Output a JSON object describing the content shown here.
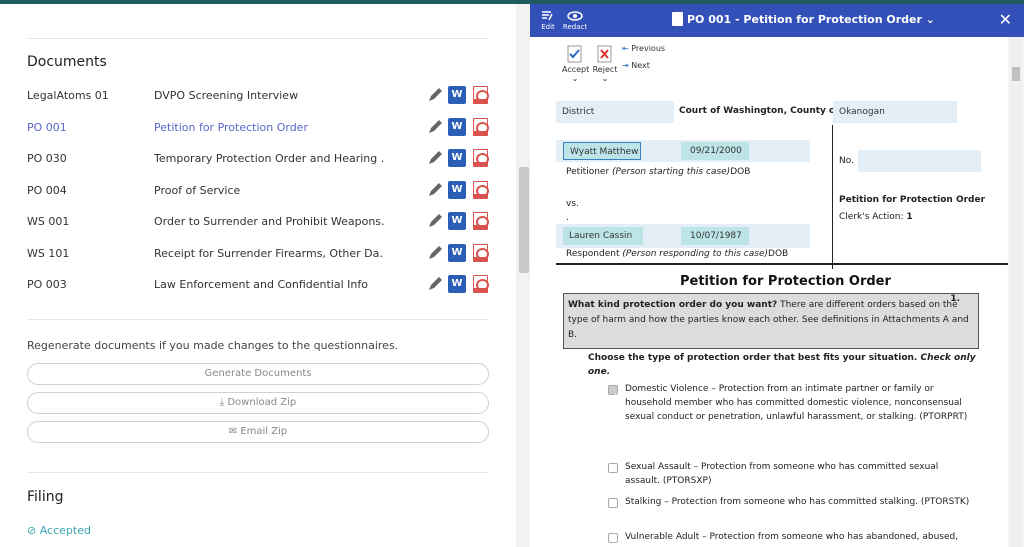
{
  "documents": {
    "heading": "Documents",
    "items": [
      {
        "code": "LegalAtoms 01",
        "title": "DVPO Screening Interview",
        "active": false
      },
      {
        "code": "PO 001",
        "title": "Petition for Protection Order",
        "active": true
      },
      {
        "code": "PO 030",
        "title": "Temporary Protection Order and Hearing …",
        "active": false
      },
      {
        "code": "PO 004",
        "title": "Proof of Service",
        "active": false
      },
      {
        "code": "WS 001",
        "title": "Order to Surrender and Prohibit Weapons…",
        "active": false
      },
      {
        "code": "WS 101",
        "title": "Receipt for Surrender Firearms, Other Da…",
        "active": false
      },
      {
        "code": "PO 003",
        "title": "Law Enforcement and Confidential Info",
        "active": false
      }
    ],
    "word_glyph": "W",
    "regen_text": "Regenerate documents if you made changes to the questionnaires.",
    "generate_label": "Generate Documents",
    "zip_label": "Download Zip",
    "email_label": "Email Zip"
  },
  "filing": {
    "heading": "Filing",
    "status": "Accepted"
  },
  "viewer": {
    "edit_label": "Edit",
    "redact_label": "Redact",
    "title": "PO 001 - Petition for Protection Order",
    "accept_label": "Accept",
    "reject_label": "Reject",
    "previous_label": "Previous",
    "next_label": "Next",
    "district_label": "District",
    "court_label": "Court of Washington, County of",
    "county_value": "Okanogan",
    "petitioner_name": "Wyatt  Matthew",
    "petitioner_dob": "09/21/2000",
    "petitioner_label_prefix": "Petitioner ",
    "petitioner_label_italic": "(Person starting this case)",
    "petitioner_label_suffix": "DOB",
    "vs": "vs.",
    "dot": ".",
    "respondent_name": "Lauren  Cassin",
    "respondent_dob": "10/07/1987",
    "respondent_label_prefix": "Respondent ",
    "respondent_label_italic": "(Person responding to this case)",
    "respondent_label_suffix": "DOB",
    "no_label": "No.",
    "side_title": "Petition for Protection Order",
    "clerk_label": "Clerk's Action:",
    "clerk_value": "1",
    "main_title": "Petition for Protection Order",
    "section_num": "1.",
    "q_bold": "What kind protection order do you want?",
    "q_rest": " There are different orders based on the type of harm and how the parties know each other. See definitions in Attachments A and B.",
    "choose_bold": "Choose the type of protection order that best fits your situation.",
    "choose_italic": " Check only one.",
    "options": [
      {
        "name": "Domestic Violence",
        "desc": "Protection from an intimate partner or family or household member who has committed domestic violence, nonconsensual sexual conduct or penetration, unlawful harassment, or stalking. (PTORPRT)",
        "checked": true
      },
      {
        "name": "Sexual Assault",
        "desc": "Protection from someone who has committed sexual assault. (PTORSXP)",
        "checked": false
      },
      {
        "name": "Stalking",
        "desc": "Protection from someone who has committed stalking. (PTORSTK)",
        "checked": false
      },
      {
        "name": "Vulnerable Adult",
        "desc": "Protection from someone who has abandoned, abused,",
        "checked": false
      }
    ]
  },
  "colors": {
    "accent": "#5a66c8",
    "header": "#3350b8",
    "accepted": "#3aa6b3"
  }
}
